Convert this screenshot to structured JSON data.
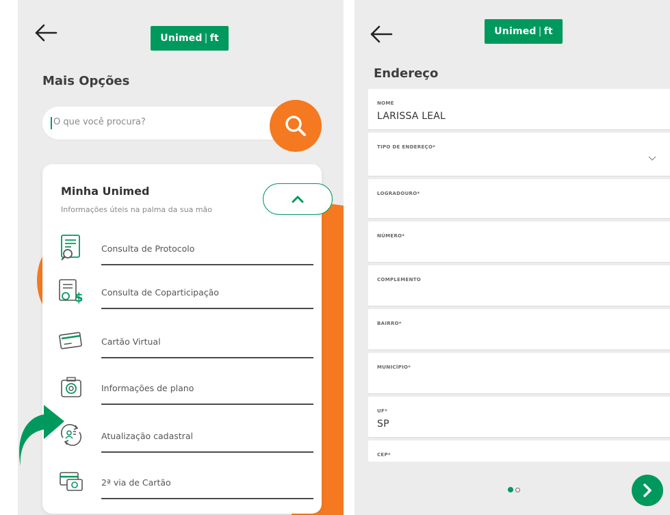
{
  "brand": {
    "logo_text": "Unimed",
    "logo_mark": "ft",
    "green": "#00995d",
    "orange": "#f47920"
  },
  "left_screen": {
    "title": "Mais Opções",
    "search": {
      "placeholder": "O que você procura?"
    },
    "card": {
      "title": "Minha Unimed",
      "subtitle": "Informações úteis na palma da sua mão",
      "items": [
        {
          "label": "Consulta de Protocolo",
          "icon": "protocol-search-icon"
        },
        {
          "label": "Consulta de Coparticipação",
          "icon": "coparticipation-icon"
        },
        {
          "label": "Cartão Virtual",
          "icon": "virtual-card-icon"
        },
        {
          "label": "Informações de plano",
          "icon": "plan-info-icon"
        },
        {
          "label": "Atualização cadastral",
          "icon": "registration-update-icon"
        },
        {
          "label": "2ª via de Cartão",
          "icon": "card-copy-icon"
        }
      ]
    }
  },
  "right_screen": {
    "title": "Endereço",
    "fields": [
      {
        "label": "NOME",
        "value": "LARISSA LEAL"
      },
      {
        "label": "TIPO DE ENDEREÇO*",
        "value": ""
      },
      {
        "label": "LOGRADOURO*",
        "value": ""
      },
      {
        "label": "NÚMERO*",
        "value": ""
      },
      {
        "label": "COMPLEMENTO",
        "value": ""
      },
      {
        "label": "BAIRRO*",
        "value": ""
      },
      {
        "label": "MUNICÍPIO*",
        "value": ""
      },
      {
        "label": "UF*",
        "value": "SP"
      },
      {
        "label": "CEP*",
        "value": ""
      }
    ],
    "pagination": {
      "current": 1,
      "total": 2
    }
  }
}
